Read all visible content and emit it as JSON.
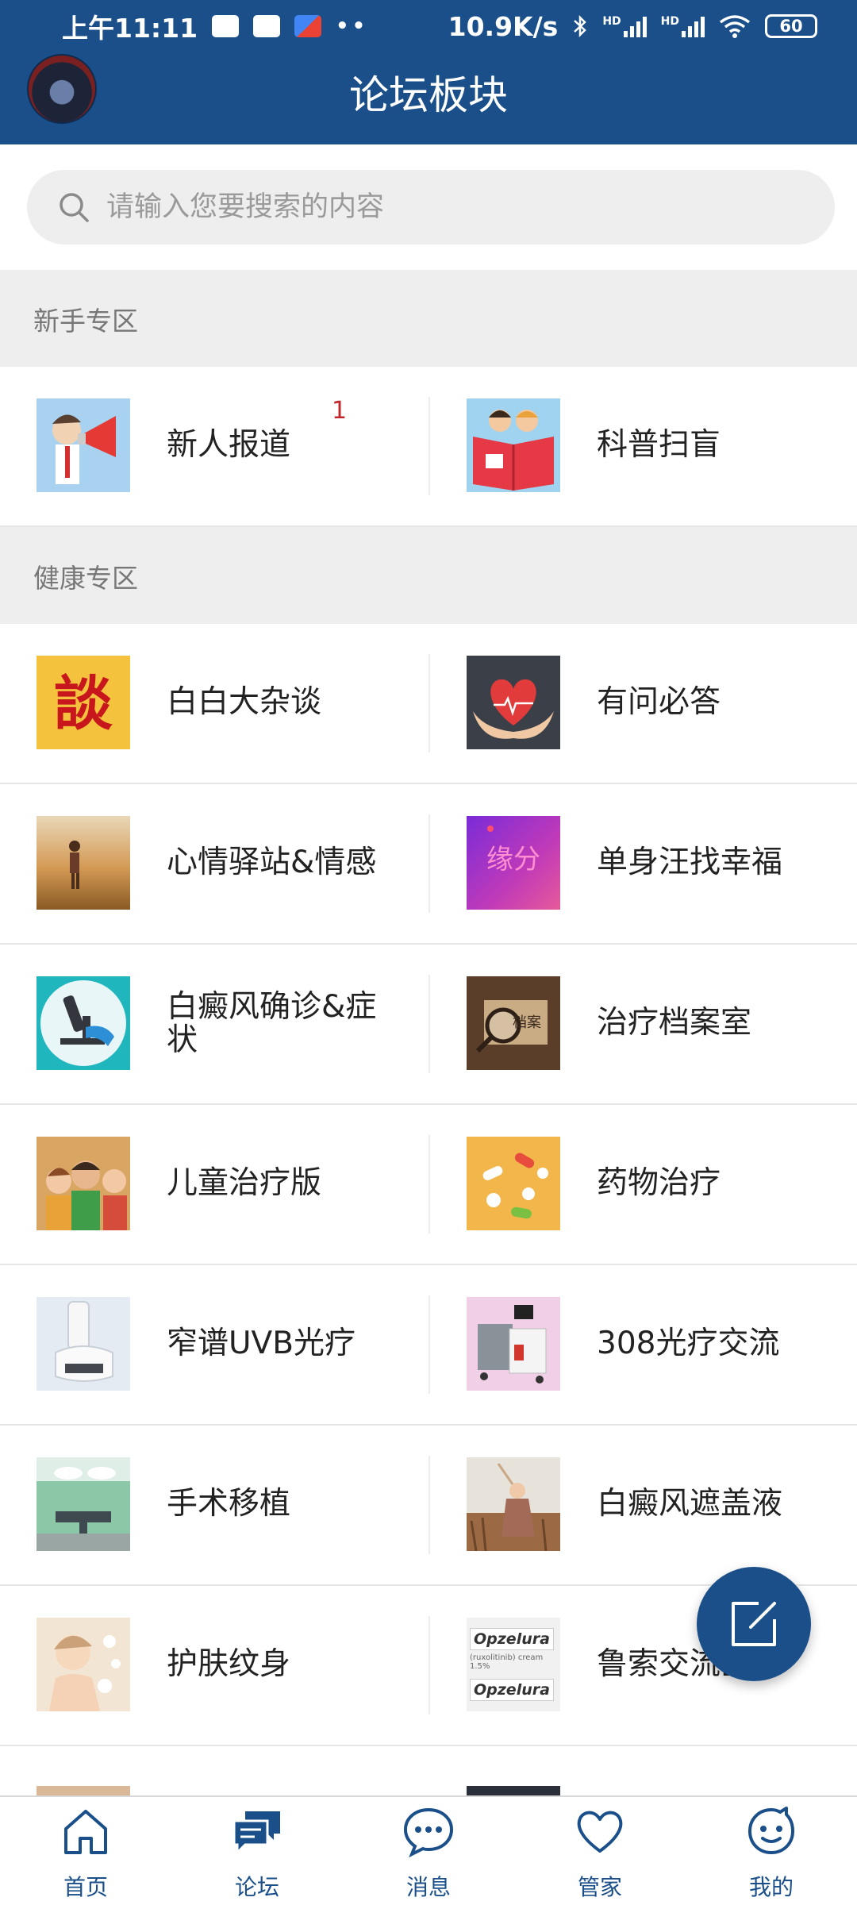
{
  "status_bar": {
    "time": "上午11:11",
    "network_speed": "10.9K/s",
    "signal_label_1": "HD",
    "signal_label_2": "HD",
    "battery": "60"
  },
  "header": {
    "title": "论坛板块"
  },
  "search": {
    "placeholder": "请输入您要搜索的内容"
  },
  "sections": [
    {
      "title": "新手专区",
      "rows": [
        {
          "left": {
            "label": "新人报道",
            "badge": "1",
            "icon": "megaphone-man-icon"
          },
          "right": {
            "label": "科普扫盲",
            "icon": "kids-reading-book-icon"
          }
        }
      ]
    },
    {
      "title": "健康专区",
      "rows": [
        {
          "left": {
            "label": "白白大杂谈",
            "icon": "tan-character-icon"
          },
          "right": {
            "label": "有问必答",
            "icon": "heart-hands-icon"
          }
        },
        {
          "left": {
            "label": "心情驿站&情感",
            "icon": "girl-field-sunset-icon"
          },
          "right": {
            "label": "单身汪找幸福",
            "icon": "yuanfen-purple-icon"
          }
        },
        {
          "left": {
            "label": "白癜风确诊&症状",
            "icon": "microscope-icon"
          },
          "right": {
            "label": "治疗档案室",
            "icon": "archive-magnifier-icon"
          }
        },
        {
          "left": {
            "label": "儿童治疗版",
            "icon": "children-photo-icon"
          },
          "right": {
            "label": "药物治疗",
            "icon": "pills-icon"
          }
        },
        {
          "left": {
            "label": "窄谱UVB光疗",
            "icon": "uvb-lamp-icon"
          },
          "right": {
            "label": "308光疗交流",
            "icon": "laser-device-icon"
          }
        },
        {
          "left": {
            "label": "手术移植",
            "icon": "operating-room-icon"
          },
          "right": {
            "label": "白癜风遮盖液",
            "icon": "woman-field-icon"
          }
        },
        {
          "left": {
            "label": "护肤纹身",
            "icon": "skincare-woman-icon"
          },
          "right": {
            "label": "鲁索交流区",
            "icon": "opzelura-cream-icon",
            "thumb_text_1": "Opzelura",
            "thumb_text_2": "(ruxolitinib) cream 1.5%"
          }
        }
      ]
    }
  ],
  "bottom_nav": [
    {
      "label": "首页",
      "icon": "home-icon"
    },
    {
      "label": "论坛",
      "icon": "forum-chat-icon"
    },
    {
      "label": "消息",
      "icon": "message-bubble-icon"
    },
    {
      "label": "管家",
      "icon": "heart-icon"
    },
    {
      "label": "我的",
      "icon": "smiley-face-icon"
    }
  ],
  "colors": {
    "brand": "#1a4f8a",
    "badge": "#c0272d",
    "section_bg": "#eeeeee"
  }
}
